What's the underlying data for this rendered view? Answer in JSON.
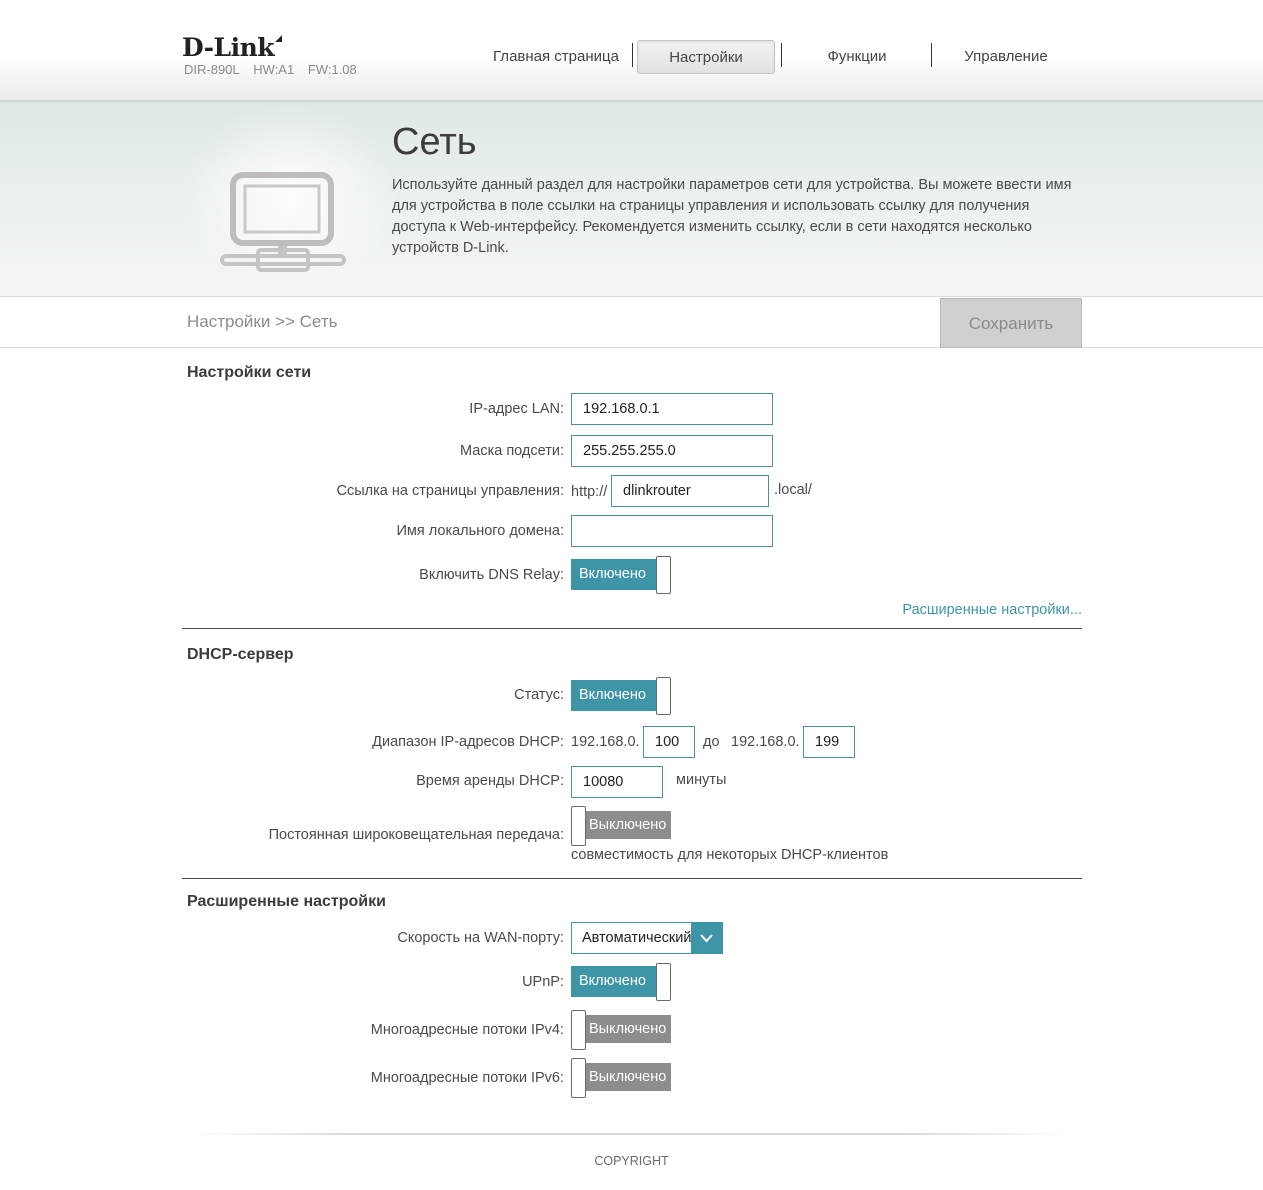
{
  "brand": {
    "logo": "D-Link",
    "model": "DIR-890L",
    "hw": "HW:A1",
    "fw": "FW:1.08"
  },
  "nav": {
    "items": [
      {
        "label": "Главная страница"
      },
      {
        "label": "Настройки"
      },
      {
        "label": "Функции"
      },
      {
        "label": "Управление"
      }
    ],
    "active": "Настройки"
  },
  "banner": {
    "title": "Сеть",
    "description": "Используйте данный раздел для настройки параметров сети для устройства. Вы можете ввести имя для устройства в поле ссылки на страницы управления и использовать ссылку для получения доступа к Web-интерфейсу. Рекомендуется изменить ссылку, если в сети находятся несколько устройств D-Link.",
    "icon": "network-computer-icon"
  },
  "breadcrumb": "Настройки >> Сеть",
  "save_label": "Сохранить",
  "network": {
    "title": "Настройки сети",
    "lan_ip_label": "IP-адрес LAN:",
    "lan_ip": "192.168.0.1",
    "subnet_label": "Маска подсети:",
    "subnet": "255.255.255.0",
    "mgmt_link_label": "Ссылка на страницы управления:",
    "mgmt_prefix": "http://",
    "mgmt_host": "dlinkrouter",
    "mgmt_suffix": ".local/",
    "domain_label": "Имя локального домена:",
    "domain": "",
    "dns_relay_label": "Включить DNS Relay:",
    "dns_relay_state": "Включено",
    "advanced_link": "Расширенные настройки..."
  },
  "dhcp": {
    "title": "DHCP-сервер",
    "status_label": "Статус:",
    "status_state": "Включено",
    "range_label": "Диапазон IP-адресов DHCP:",
    "range_prefix_start": "192.168.0.",
    "range_start": "100",
    "range_to": "до",
    "range_prefix_end": "192.168.0.",
    "range_end": "199",
    "lease_label": "Время аренды DHCP:",
    "lease": "10080",
    "lease_unit": "минуты",
    "broadcast_label": "Постоянная широковещательная передача:",
    "broadcast_state": "Выключено",
    "broadcast_note": "совместимость для некоторых DHCP-клиентов"
  },
  "advanced": {
    "title": "Расширенные настройки",
    "wan_speed_label": "Скорость на WAN-порту:",
    "wan_speed": "Автоматический",
    "upnp_label": "UPnP:",
    "upnp_state": "Включено",
    "ipv4_mcast_label": "Многоадресные потоки IPv4:",
    "ipv4_mcast_state": "Выключено",
    "ipv6_mcast_label": "Многоадресные потоки IPv6:",
    "ipv6_mcast_state": "Выключено"
  },
  "footer": {
    "copyright": "COPYRIGHT"
  },
  "colors": {
    "accent": "#3f95a8",
    "toggle_off": "#8d8d8d",
    "save_disabled": "#d0d0d0"
  }
}
